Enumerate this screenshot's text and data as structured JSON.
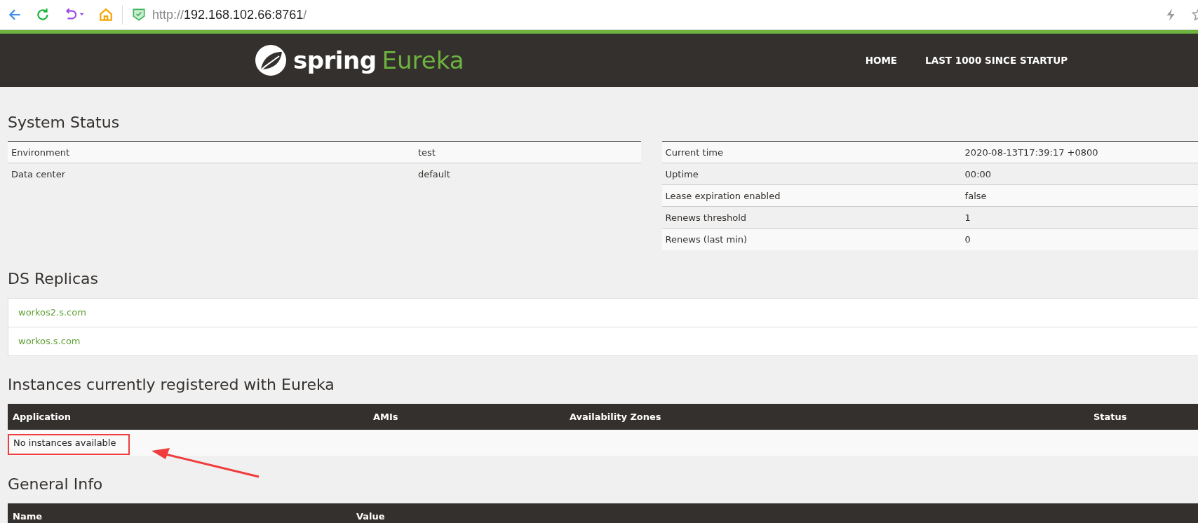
{
  "browser": {
    "url_scheme": "http://",
    "url_host": "192.168.102.66:8761",
    "url_path": "/"
  },
  "header": {
    "logo_word": "spring",
    "logo_product": "Eureka",
    "nav": [
      {
        "label": "HOME"
      },
      {
        "label": "LAST 1000 SINCE STARTUP"
      }
    ]
  },
  "system_status": {
    "title": "System Status",
    "left_rows": [
      {
        "name": "Environment",
        "value": "test"
      },
      {
        "name": "Data center",
        "value": "default"
      }
    ],
    "right_rows": [
      {
        "name": "Current time",
        "value": "2020-08-13T17:39:17 +0800"
      },
      {
        "name": "Uptime",
        "value": "00:00"
      },
      {
        "name": "Lease expiration enabled",
        "value": "false"
      },
      {
        "name": "Renews threshold",
        "value": "1"
      },
      {
        "name": "Renews (last min)",
        "value": "0"
      }
    ]
  },
  "ds_replicas": {
    "title": "DS Replicas",
    "items": [
      "workos2.s.com",
      "workos.s.com"
    ]
  },
  "instances": {
    "title": "Instances currently registered with Eureka",
    "columns": [
      "Application",
      "AMIs",
      "Availability Zones",
      "Status"
    ],
    "empty_text": "No instances available"
  },
  "general_info": {
    "title": "General Info",
    "columns": [
      "Name",
      "Value"
    ]
  }
}
